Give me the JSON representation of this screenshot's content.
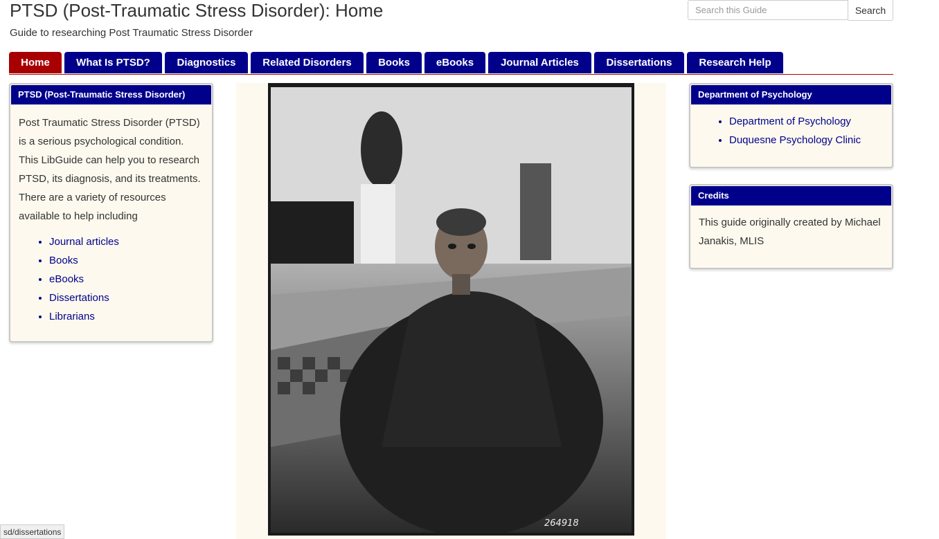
{
  "header": {
    "title": "PTSD (Post-Traumatic Stress Disorder): Home",
    "subtitle": "Guide to researching Post Traumatic Stress Disorder"
  },
  "search": {
    "placeholder": "Search this Guide",
    "button_label": "Search"
  },
  "tabs": [
    {
      "label": "Home",
      "active": true
    },
    {
      "label": "What Is PTSD?"
    },
    {
      "label": "Diagnostics"
    },
    {
      "label": "Related Disorders"
    },
    {
      "label": "Books"
    },
    {
      "label": "eBooks"
    },
    {
      "label": "Journal Articles"
    },
    {
      "label": "Dissertations"
    },
    {
      "label": "Research Help"
    }
  ],
  "left_box": {
    "title": "PTSD (Post-Traumatic Stress Disorder)",
    "paragraph": "Post Traumatic Stress Disorder (PTSD) is a serious psychological condition. This LibGuide can help you to research PTSD, its diagnosis, and its treatments. There are a variety of resources available to help including",
    "links": [
      "Journal articles",
      "Books",
      "eBooks",
      "Dissertations",
      "Librarians"
    ]
  },
  "photo": {
    "caption_number": "264918"
  },
  "dept_box": {
    "title": "Department of Psychology",
    "links": [
      "Department of Psychology",
      "Duquesne Psychology Clinic"
    ]
  },
  "credits_box": {
    "title": "Credits",
    "text": "This guide originally created by Michael Janakis, MLIS"
  },
  "status_bar": {
    "url": "sd/dissertations"
  },
  "colors": {
    "tab": "#00008b",
    "tab_active": "#a80000",
    "box_header": "#00008b",
    "box_body": "#fdf9ee",
    "link": "#00008b"
  }
}
